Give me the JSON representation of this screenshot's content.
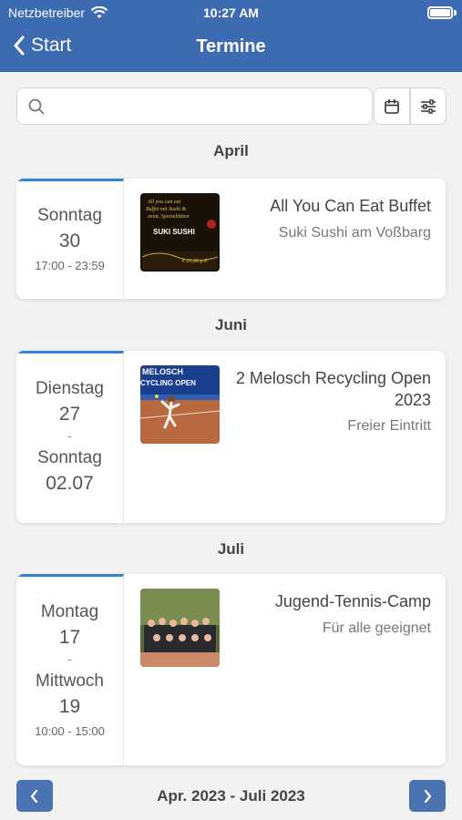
{
  "status_bar": {
    "carrier": "Netzbetreiber",
    "time": "10:27 AM"
  },
  "nav": {
    "back_label": "Start",
    "title": "Termine"
  },
  "search": {
    "placeholder": ""
  },
  "months": [
    "April",
    "Juni",
    "Juli"
  ],
  "events": [
    {
      "start_day": "Sonntag",
      "start_num": "30",
      "end_day": "",
      "end_num": "",
      "time": "17:00 - 23:59",
      "title": "All You Can Eat Buffet",
      "subtitle": "Suki Sushi am Voßbarg",
      "image_text": [
        "All you can eat",
        "Buffet mit Sushi &",
        "asiat. Spezialitäten",
        "SUKI SUSHI",
        "€ 21,90 p.P."
      ]
    },
    {
      "start_day": "Dienstag",
      "start_num": "27",
      "end_day": "Sonntag",
      "end_num": "02.07",
      "time": "",
      "title": "2 Melosch Recycling Open 2023",
      "subtitle": "Freier Eintritt",
      "image_text": [
        "MELOSCH",
        "CYCLING OPEN"
      ]
    },
    {
      "start_day": "Montag",
      "start_num": "17",
      "end_day": "Mittwoch",
      "end_num": "19",
      "time": "10:00 - 15:00",
      "title": "Jugend-Tennis-Camp",
      "subtitle": "Für alle geeignet",
      "image_text": []
    }
  ],
  "pager": {
    "label": "Apr. 2023 - Juli 2023"
  },
  "colors": {
    "header": "#3c6bb2",
    "accent": "#2f86d6",
    "pager_button": "#4a74b1"
  },
  "icons": [
    "wifi-icon",
    "battery-icon",
    "chevron-left-icon",
    "search-icon",
    "calendar-icon",
    "sliders-icon",
    "chevron-right-icon"
  ]
}
